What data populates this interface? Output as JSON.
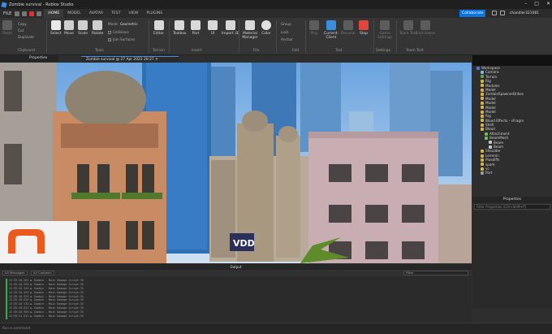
{
  "window": {
    "title": "Zombie survival - Roblox Studio"
  },
  "menu": {
    "file": "FILE",
    "tabs": [
      "HOME",
      "MODEL",
      "AVATAR",
      "TEST",
      "VIEW",
      "PLUGINS"
    ],
    "active_tab": "HOME",
    "collaborate": "Collaborate",
    "user": "chandler321081"
  },
  "ribbon": {
    "clipboard_label": "Clipboard",
    "clipboard_buttons": [
      "Paste",
      "Copy",
      "Cut",
      "Duplicate"
    ],
    "tools": [
      "Select",
      "Move",
      "Scale",
      "Rotate"
    ],
    "mode_label": "Mode:",
    "mode_value": "Geometric",
    "collisions": "Collisions",
    "join_surfaces": "Join Surfaces",
    "tools_label": "Tools",
    "terrain_editor": "Editor",
    "terrain_label": "Terrain",
    "insert": [
      "Toolbox",
      "Part",
      "UI",
      "Import 3D"
    ],
    "insert_label": "Insert",
    "file_group": [
      "Material Manager",
      "Color"
    ],
    "file_label": "File",
    "edit_group": [
      "Group",
      "Lock",
      "Anchor"
    ],
    "edit_label": "Edit",
    "test_buttons": [
      "Play",
      "Current: Client",
      "Resume",
      "Stop"
    ],
    "test_label": "Test",
    "settings_buttons": [
      "Game Settings"
    ],
    "settings_label": "Settings",
    "team_buttons": [
      "Team Test",
      "Exit Game"
    ],
    "team_label": "Team Test"
  },
  "panels": {
    "properties_tab": "Properties",
    "document_tab": "Zombie survival @ 27 Apr 2022 20:27",
    "explorer_tab": "Explorer",
    "properties_header": "Properties",
    "properties_filter": "Filter Properties (Ctrl+Shift+P)"
  },
  "explorer": [
    {
      "label": "Workspace",
      "indent": 1,
      "color": "#4b7bd1"
    },
    {
      "label": "Camera",
      "indent": 2,
      "color": "#7fb3e6"
    },
    {
      "label": "Terrain",
      "indent": 2,
      "color": "#5aa64b"
    },
    {
      "label": "Rig",
      "indent": 2,
      "color": "#d8b04a"
    },
    {
      "label": "Modules",
      "indent": 2,
      "color": "#d8b04a"
    },
    {
      "label": "Model",
      "indent": 2,
      "color": "#d8b04a"
    },
    {
      "label": "ZombieSpawnerBrikes",
      "indent": 2,
      "color": "#d8b04a"
    },
    {
      "label": "Model",
      "indent": 2,
      "color": "#d8b04a"
    },
    {
      "label": "Model",
      "indent": 2,
      "color": "#d8b04a"
    },
    {
      "label": "Model",
      "indent": 2,
      "color": "#d8b04a"
    },
    {
      "label": "Model",
      "indent": 2,
      "color": "#d8b04a"
    },
    {
      "label": "Rig",
      "indent": 2,
      "color": "#d8b04a"
    },
    {
      "label": "Blood Effects - vFragm",
      "indent": 2,
      "color": "#d8b04a"
    },
    {
      "label": "Shell",
      "indent": 2,
      "color": "#d8b04a"
    },
    {
      "label": "Blood",
      "indent": 2,
      "color": "#d8b04a"
    },
    {
      "label": "Attachment",
      "indent": 3,
      "color": "#6bbf59"
    },
    {
      "label": "BeamMesh",
      "indent": 3,
      "color": "#6bbf59"
    },
    {
      "label": "Beam",
      "indent": 4,
      "color": "#c7c7c7"
    },
    {
      "label": "Beam",
      "indent": 4,
      "color": "#c7c7c7"
    },
    {
      "label": "Shoulder",
      "indent": 2,
      "color": "#d8b04a"
    },
    {
      "label": "Lemmin",
      "indent": 2,
      "color": "#d8b04a"
    },
    {
      "label": "Plusdiffs",
      "indent": 2,
      "color": "#d8b04a"
    },
    {
      "label": "spark",
      "indent": 2,
      "color": "#d8b04a"
    },
    {
      "label": "vc",
      "indent": 2,
      "color": "#d8b04a"
    },
    {
      "label": "Part",
      "indent": 2,
      "color": "#9a9a9a"
    }
  ],
  "output": {
    "title": "Output",
    "filter_all_messages": "All Messages",
    "filter_all_contexts": "All Contexts",
    "filter_search": "Filter",
    "lines": [
      "22:35:10.201  ▶  Zombie - Main Damage Script:35",
      "22:35:10.295  ▶  Zombie - Main Damage Script:35",
      "22:35:10.345  ▶  Zombie - Main Damage Script:35",
      "22:35:10.455  ▶  Zombie - Main Damage Script:35",
      "22:35:10.521  ▶  Zombie - Main Damage Script:35",
      "22:35:10.625  ▶  Zombie - Main Damage Script:35",
      "22:35:10.735  ▶  Zombie - Main Damage Script:35",
      "22:35:10.812  ▶  Zombie - Main Damage Script:35",
      "22:35:10.905  ▶  Zombie - Main Damage Script:35",
      "22:35:11.011  ▶  Zombie - Main Damage Script:35"
    ]
  },
  "command_bar": {
    "placeholder": "Run a command"
  },
  "viewport": {
    "sign_text": "VDD"
  }
}
